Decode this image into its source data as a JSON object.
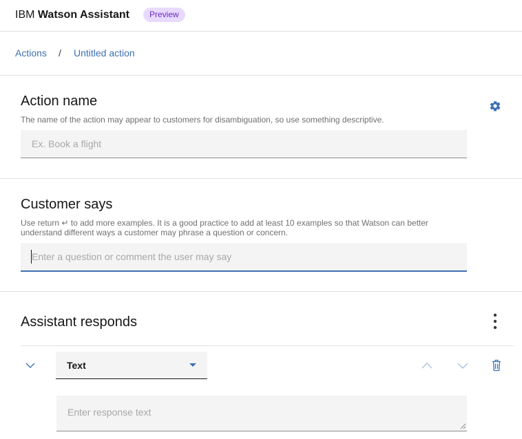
{
  "header": {
    "brand_prefix": "IBM",
    "brand_name": "Watson Assistant",
    "badge": "Preview"
  },
  "breadcrumb": {
    "items": [
      "Actions",
      "Untitled action"
    ],
    "separator": "/"
  },
  "action_name": {
    "title": "Action name",
    "helper": "The name of the action may appear to customers for disambiguation, so use something descriptive.",
    "placeholder": "Ex. Book a flight",
    "value": "",
    "settings_icon": "gear-icon"
  },
  "customer_says": {
    "title": "Customer says",
    "helper_line1": "Use return ↵ to add more examples. It is a good practice to add at least 10 examples so that Watson can better",
    "helper_line2": "understand different ways a customer may phrase a question or concern.",
    "placeholder": "Enter a question or comment the user may say",
    "value": ""
  },
  "assistant_responds": {
    "title": "Assistant responds",
    "menu_icon": "overflow-menu-vertical-icon",
    "response_type": "Text",
    "response_placeholder": "Enter response text",
    "response_value": ""
  },
  "colors": {
    "accent": "#3d70b2",
    "badge_bg": "#e8daff",
    "badge_text": "#6929c4",
    "field_bg": "#f4f4f4"
  }
}
